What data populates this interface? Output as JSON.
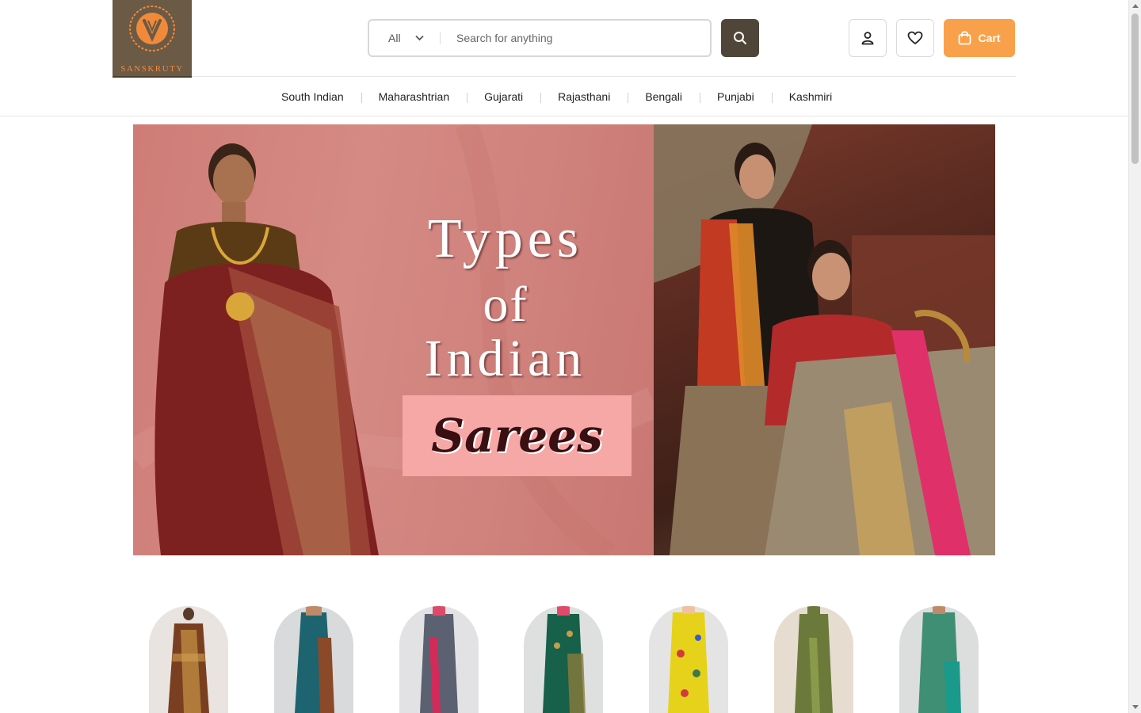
{
  "brand": {
    "name": "SANSKRUTY"
  },
  "search": {
    "category": "All",
    "placeholder": "Search for anything"
  },
  "header_actions": {
    "cart_label": "Cart"
  },
  "nav": {
    "items": [
      "South Indian",
      "Maharashtrian",
      "Gujarati",
      "Rajasthani",
      "Bengali",
      "Punjabi",
      "Kashmiri"
    ]
  },
  "banner": {
    "line1": "Types",
    "line2": "of",
    "line3": "Indian",
    "highlight": "Sarees"
  },
  "colors": {
    "brand_bg": "#6b5a45",
    "accent_orange": "#f9a14a",
    "search_button": "#4f4639",
    "banner_pink": "#d0827d"
  },
  "products": [
    {
      "icon": "saree-maroon-gold"
    },
    {
      "icon": "saree-teal"
    },
    {
      "icon": "saree-grey-pink"
    },
    {
      "icon": "saree-green"
    },
    {
      "icon": "saree-yellow-floral"
    },
    {
      "icon": "saree-olive"
    },
    {
      "icon": "saree-seagreen"
    }
  ]
}
